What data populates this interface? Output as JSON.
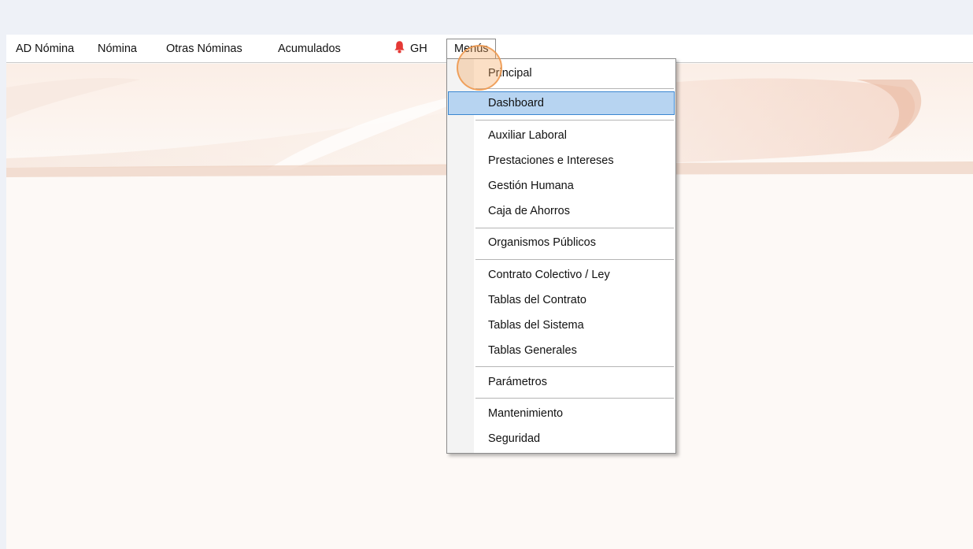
{
  "menubar": {
    "items": [
      "AD Nómina",
      "Nómina",
      "Otras Nóminas",
      "Acumulados",
      "GH",
      "Menús"
    ],
    "bell_color": "#e53935"
  },
  "dropdown": {
    "items": [
      "Principal",
      "Dashboard",
      "Auxiliar Laboral",
      "Prestaciones e Intereses",
      "Gestión Humana",
      "Caja de Ahorros",
      "Organismos Públicos",
      "Contrato Colectivo / Ley",
      "Tablas del Contrato",
      "Tablas del Sistema",
      "Tablas Generales",
      "Parámetros",
      "Mantenimiento",
      "Seguridad"
    ],
    "highlighted": "Dashboard",
    "highlight_color": "#b7d4f1"
  }
}
